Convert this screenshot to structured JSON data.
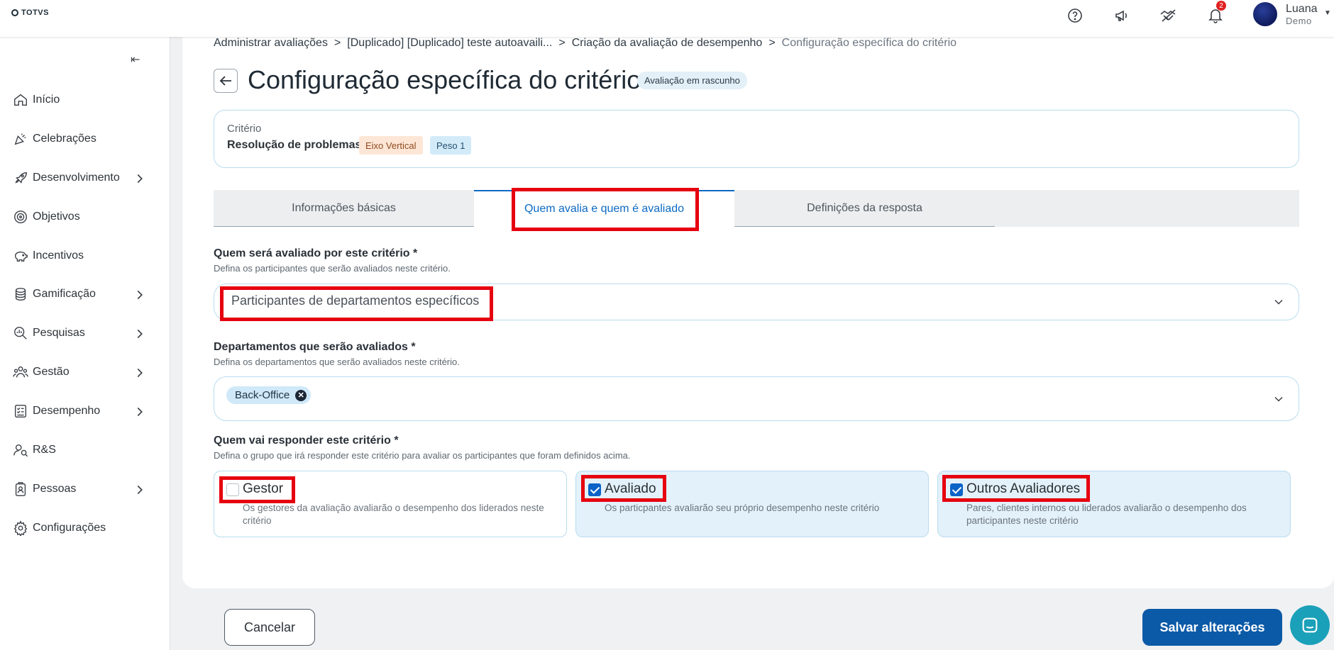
{
  "app": {
    "logo_text": "TOTVS"
  },
  "topbar": {
    "notification_count": "2",
    "user_name": "Luana",
    "user_role": "Demo"
  },
  "sidebar": {
    "items": [
      {
        "label": "Início",
        "has_children": false
      },
      {
        "label": "Celebrações",
        "has_children": false
      },
      {
        "label": "Desenvolvimento",
        "has_children": true
      },
      {
        "label": "Objetivos",
        "has_children": false
      },
      {
        "label": "Incentivos",
        "has_children": false
      },
      {
        "label": "Gamificação",
        "has_children": true
      },
      {
        "label": "Pesquisas",
        "has_children": true
      },
      {
        "label": "Gestão",
        "has_children": true
      },
      {
        "label": "Desempenho",
        "has_children": true
      },
      {
        "label": "R&S",
        "has_children": false
      },
      {
        "label": "Pessoas",
        "has_children": true
      },
      {
        "label": "Configurações",
        "has_children": false
      }
    ]
  },
  "breadcrumb": {
    "items": [
      "Administrar avaliações",
      "[Duplicado] [Duplicado] teste autoavaili...",
      "Criação da avaliação de desempenho",
      "Configuração específica do critério"
    ],
    "separator": ">"
  },
  "page": {
    "title": "Configuração específica do critério",
    "status": "Avaliação em rascunho"
  },
  "criterion": {
    "label": "Critério",
    "name": "Resolução de problemas",
    "axis_tag": "Eixo Vertical",
    "weight_tag": "Peso 1"
  },
  "tabs": [
    {
      "label": "Informações básicas",
      "active": false
    },
    {
      "label": "Quem avalia e quem é avaliado",
      "active": true
    },
    {
      "label": "Definições da resposta",
      "active": false
    }
  ],
  "evaluated": {
    "title": "Quem será avaliado por este critério *",
    "subtitle": "Defina os participantes que serão avaliados neste critério.",
    "value": "Participantes de departamentos específicos"
  },
  "departments": {
    "title": "Departamentos que serão avaliados *",
    "subtitle": "Defina os departamentos que serão avaliados neste critério.",
    "chips": [
      "Back-Office"
    ]
  },
  "responders": {
    "title": "Quem vai responder este critério *",
    "subtitle": "Defina o grupo que irá responder este critério para avaliar os participantes que foram definidos acima.",
    "options": [
      {
        "label": "Gestor",
        "description": "Os gestores da avaliação avaliarão o desempenho dos liderados neste critério",
        "checked": false
      },
      {
        "label": "Avaliado",
        "description": "Os particpantes avaliarão seu próprio desempenho neste critério",
        "checked": true
      },
      {
        "label": "Outros Avaliadores",
        "description": "Pares, clientes internos ou liderados avaliarão o desempenho dos participantes neste critério",
        "checked": true
      }
    ]
  },
  "footer": {
    "cancel_label": "Cancelar",
    "save_label": "Salvar alterações"
  },
  "colors": {
    "primary": "#0b5aa7",
    "tab_active": "#0c6ac4",
    "highlight": "#e6000f",
    "chat": "#1ba0b9"
  }
}
